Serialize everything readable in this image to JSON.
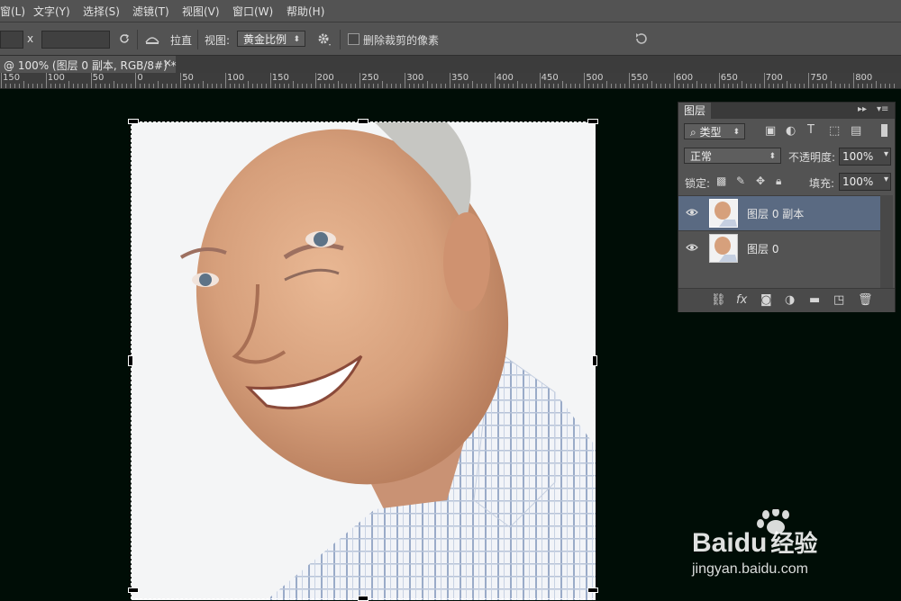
{
  "menus": [
    "窗(L)",
    "文字(Y)",
    "选择(S)",
    "滤镜(T)",
    "视图(V)",
    "窗口(W)",
    "帮助(H)"
  ],
  "options": {
    "x_label": "x",
    "straighten_label": "拉直",
    "view_label": "视图:",
    "view_value": "黄金比例",
    "delete_cropped_label": "删除裁剪的像素"
  },
  "document_tab": {
    "title": "@ 100% (图层 0 副本, RGB/8#) *",
    "close": "×"
  },
  "ruler_labels": [
    "150",
    "100",
    "50",
    "0",
    "50",
    "100",
    "150",
    "200",
    "250",
    "300",
    "350",
    "400",
    "450",
    "500",
    "550",
    "600",
    "650",
    "700",
    "750",
    "800"
  ],
  "layers_panel": {
    "tab_title": "图层",
    "filter_kind": "类型",
    "blend_mode": "正常",
    "opacity_label": "不透明度:",
    "opacity_value": "100%",
    "lock_label": "锁定:",
    "fill_label": "填充:",
    "fill_value": "100%",
    "layers": [
      {
        "name": "图层 0 副本",
        "selected": true
      },
      {
        "name": "图层 0",
        "selected": false
      }
    ],
    "selected_color": "#5a6a82"
  },
  "watermark": {
    "brand": "Bai",
    "brand2": "du",
    "cn": "经验",
    "url": "jingyan.baidu.com"
  },
  "colors": {
    "canvas_bg": "#000d06",
    "ui_bg": "#535353"
  }
}
